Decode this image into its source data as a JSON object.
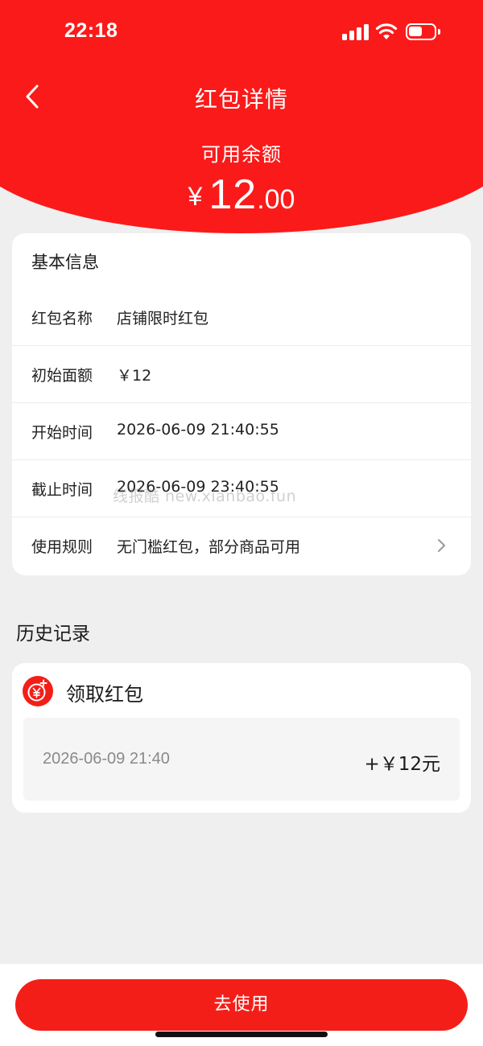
{
  "status_bar": {
    "time": "22:18"
  },
  "nav": {
    "title": "红包详情",
    "back_icon": "chevron-left-icon"
  },
  "balance": {
    "label": "可用余额",
    "currency": "¥",
    "integer": "12",
    "decimal": ".00"
  },
  "basic_info": {
    "heading": "基本信息",
    "rows": [
      {
        "label": "红包名称",
        "value": "店铺限时红包"
      },
      {
        "label": "初始面额",
        "value": "￥12"
      },
      {
        "label": "开始时间",
        "value": "2026-06-09 21:40:55"
      },
      {
        "label": "截止时间",
        "value": "2026-06-09 23:40:55"
      },
      {
        "label": "使用规则",
        "value": "无门槛红包，部分商品可用"
      }
    ]
  },
  "watermark": "线报酷  new.xianbao.fun",
  "history": {
    "title": "历史记录",
    "record_type": "领取红包",
    "record_icon": "red-packet-yen-icon",
    "records": [
      {
        "time": "2026-06-09 21:40",
        "amount": "+￥12元"
      }
    ]
  },
  "action_button": "去使用",
  "colors": {
    "accent": "#fb1a1a",
    "button": "#f41e18",
    "background": "#efefef"
  }
}
